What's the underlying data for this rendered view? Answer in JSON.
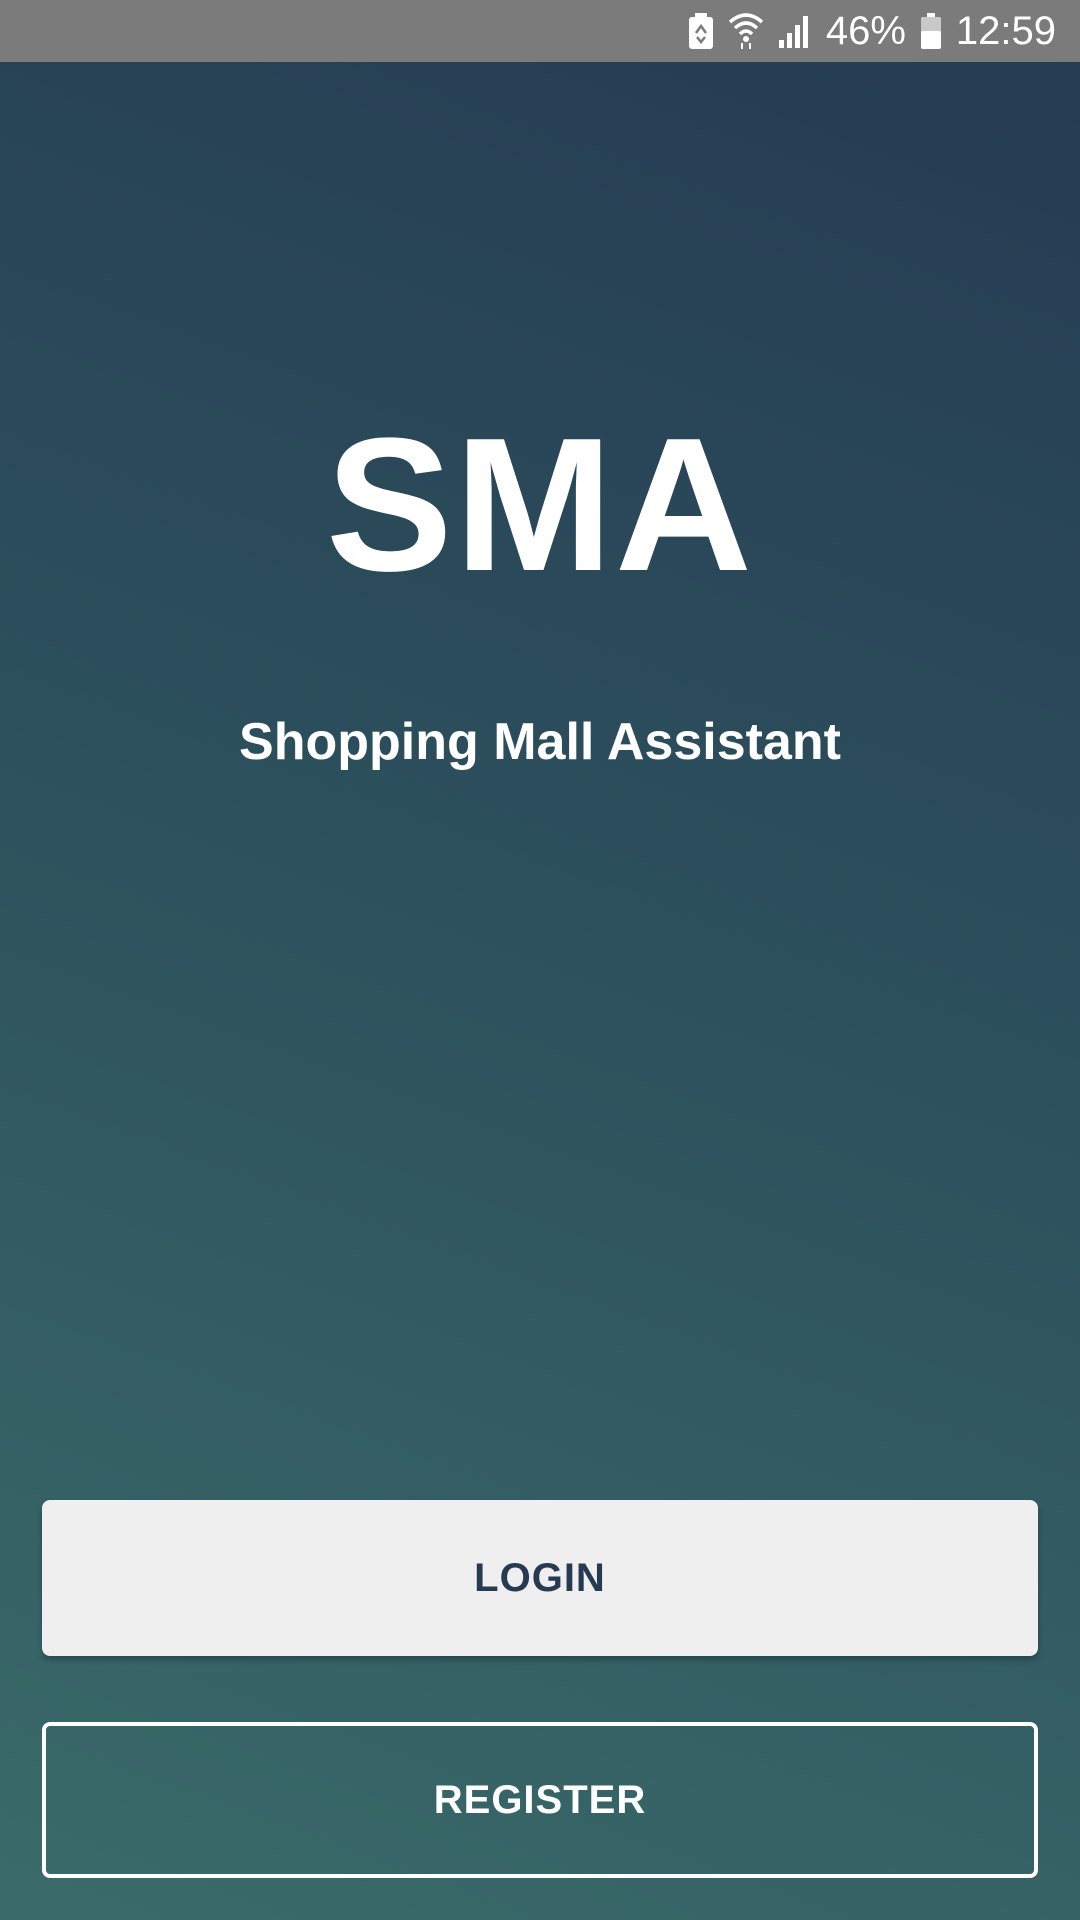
{
  "status_bar": {
    "battery_percent": "46%",
    "time": "12:59",
    "icons": [
      "battery-saver-icon",
      "wifi-icon",
      "signal-icon",
      "battery-icon"
    ]
  },
  "brand": {
    "title": "SMA",
    "subtitle": "Shopping Mall Assistant"
  },
  "actions": {
    "login_label": "LOGIN",
    "register_label": "REGISTER"
  },
  "colors": {
    "status_bar_bg": "#7b7b7b",
    "gradient_top": "#253a52",
    "gradient_bottom": "#3a6b6a",
    "login_bg": "#efefef",
    "login_text": "#263a52",
    "register_border": "#ffffff"
  }
}
